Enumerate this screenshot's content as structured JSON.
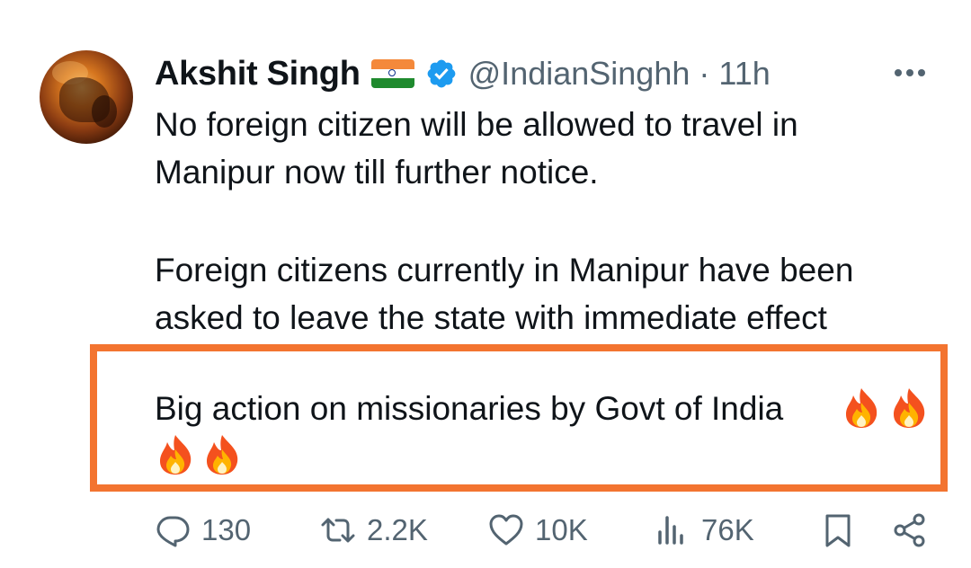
{
  "author": {
    "name": "Akshit Singh",
    "flag_icon": "india-flag-emoji",
    "verified_icon": "verified-badge-icon",
    "handle": "@IndianSinghh",
    "separator": "·",
    "time": "11h"
  },
  "tweet": {
    "paragraph1": "No foreign citizen will be allowed to travel in\nManipur now till further notice.",
    "paragraph2": "Foreign citizens currently in Manipur have been\nasked to leave the state with immediate effect",
    "paragraph3": "Big action on missionaries by Govt of India",
    "emoji": [
      "fire",
      "fire",
      "fire",
      "fire"
    ]
  },
  "highlight": {
    "color": "#f37430"
  },
  "actions": {
    "replies": "130",
    "reposts": "2.2K",
    "likes": "10K",
    "views": "76K"
  },
  "colors": {
    "text": "#0f1419",
    "secondary": "#536471",
    "verified": "#1d9bf0",
    "highlight": "#f37430"
  }
}
